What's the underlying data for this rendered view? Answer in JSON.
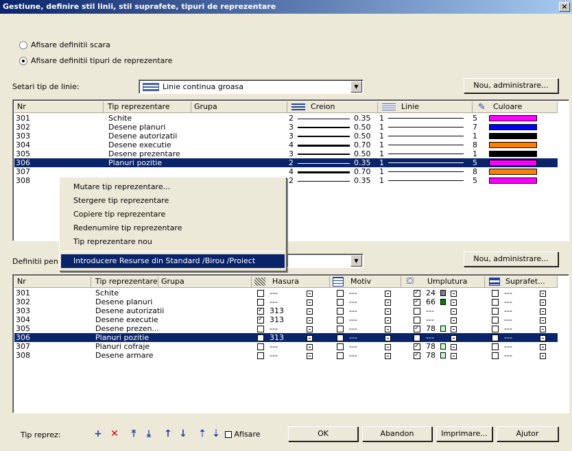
{
  "window": {
    "title": "Gestiune, definire stil linii, stil suprafete, tipuri de reprezentare",
    "close": "×"
  },
  "radios": [
    {
      "label": "Afisare definitii scara",
      "checked": false
    },
    {
      "label": "Afisare definitii tipuri de reprezentare",
      "checked": true
    }
  ],
  "setari": {
    "label": "Setari tip de linie:",
    "value": "Linie continua groasa",
    "button": "Nou, administrare..."
  },
  "top_list": {
    "headers": [
      "Nr",
      "Tip reprezentare",
      "Grupa",
      "Creion",
      "Linie",
      "Culoare"
    ],
    "rows": [
      {
        "nr": "301",
        "tip": "Schite",
        "creion": "2",
        "thick": "0.35",
        "linie": "1",
        "culoare": "5",
        "color": "#ff00ff",
        "weight": 1,
        "sel": false
      },
      {
        "nr": "302",
        "tip": "Desene planuri",
        "creion": "3",
        "thick": "0.50",
        "linie": "1",
        "culoare": "7",
        "color": "#0000ff",
        "weight": 2,
        "sel": false
      },
      {
        "nr": "303",
        "tip": "Desene autorizatii",
        "creion": "3",
        "thick": "0.50",
        "linie": "1",
        "culoare": "1",
        "color": "#000000",
        "weight": 2,
        "sel": false
      },
      {
        "nr": "304",
        "tip": "Desene executie",
        "creion": "4",
        "thick": "0.70",
        "linie": "1",
        "culoare": "8",
        "color": "#ff8000",
        "weight": 3,
        "sel": false
      },
      {
        "nr": "305",
        "tip": "Desene prezentare",
        "creion": "3",
        "thick": "0.50",
        "linie": "1",
        "culoare": "1",
        "color": "#000000",
        "weight": 2,
        "sel": false
      },
      {
        "nr": "306",
        "tip": "Planuri pozitie",
        "creion": "2",
        "thick": "0.35",
        "linie": "1",
        "culoare": "5",
        "color": "#ff00ff",
        "weight": 1,
        "sel": true
      },
      {
        "nr": "307",
        "tip": "",
        "creion": "4",
        "thick": "0.70",
        "linie": "1",
        "culoare": "8",
        "color": "#ff8000",
        "weight": 3,
        "sel": false
      },
      {
        "nr": "308",
        "tip": "",
        "creion": "2",
        "thick": "0.35",
        "linie": "1",
        "culoare": "5",
        "color": "#ff00ff",
        "weight": 1,
        "sel": false
      }
    ]
  },
  "context_menu": [
    "Mutare tip reprezentare...",
    "Stergere tip reprezentare",
    "Copiere tip reprezentare",
    "Redenumire tip reprezentare",
    "Tip reprezentare nou",
    "Introducere Resurse din Standard /Birou /Proiect"
  ],
  "definitii": {
    "label": "Definitii pen",
    "button": "Nou, administrare..."
  },
  "bottom_list": {
    "headers": [
      "Nr",
      "Tip reprezentare",
      "Grupa",
      "Hasura",
      "Motiv",
      "Umplutura",
      "Suprafet..."
    ],
    "rows": [
      {
        "nr": "301",
        "tip": "Schite",
        "has_on": false,
        "has": "---",
        "mot_on": false,
        "mot": "---",
        "ump_on": true,
        "ump": "24",
        "ump_color": "#808080",
        "sup": "---",
        "sel": false
      },
      {
        "nr": "302",
        "tip": "Desene planuri",
        "has_on": false,
        "has": "---",
        "mot_on": false,
        "mot": "---",
        "ump_on": true,
        "ump": "66",
        "ump_color": "#008000",
        "sup": "---",
        "sel": false
      },
      {
        "nr": "303",
        "tip": "Desene autorizatii",
        "has_on": true,
        "has": "313",
        "mot_on": false,
        "mot": "---",
        "ump_on": false,
        "ump": "---",
        "ump_color": "",
        "sup": "---",
        "sel": false
      },
      {
        "nr": "304",
        "tip": "Desene executie",
        "has_on": true,
        "has": "313",
        "mot_on": false,
        "mot": "---",
        "ump_on": false,
        "ump": "---",
        "ump_color": "",
        "sup": "---",
        "sel": false
      },
      {
        "nr": "305",
        "tip": "Desene prezen...",
        "has_on": false,
        "has": "---",
        "mot_on": false,
        "mot": "---",
        "ump_on": true,
        "ump": "78",
        "ump_color": "#c0ffc0",
        "sup": "---",
        "sel": false
      },
      {
        "nr": "306",
        "tip": "Planuri pozitie",
        "has_on": true,
        "has": "313",
        "mot_on": false,
        "mot": "---",
        "ump_on": false,
        "ump": "---",
        "ump_color": "",
        "sup": "---",
        "sel": true
      },
      {
        "nr": "307",
        "tip": "Planuri cofraje",
        "has_on": false,
        "has": "---",
        "mot_on": false,
        "mot": "---",
        "ump_on": true,
        "ump": "78",
        "ump_color": "#c0ffc0",
        "sup": "---",
        "sel": false
      },
      {
        "nr": "308",
        "tip": "Desene armare",
        "has_on": false,
        "has": "---",
        "mot_on": false,
        "mot": "---",
        "ump_on": true,
        "ump": "78",
        "ump_color": "#c0ffc0",
        "sup": "---",
        "sel": false
      }
    ]
  },
  "footer": {
    "tip_label": "Tip reprez:",
    "afisare": "Afisare",
    "ok": "OK",
    "abandon": "Abandon",
    "imprimare": "Imprimare...",
    "ajutor": "Ajutor"
  },
  "colors": {
    "title_start": "#0a246a",
    "title_end": "#a6caf0",
    "selection": "#0a246a",
    "dialog": "#ece9d8"
  }
}
